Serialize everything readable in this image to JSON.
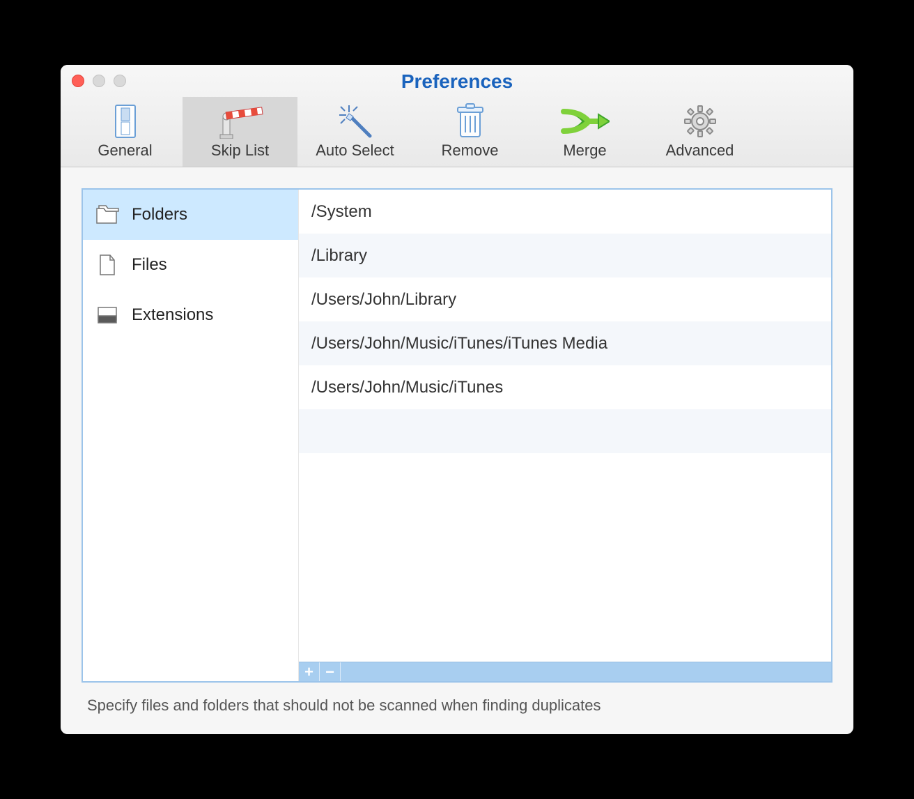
{
  "window": {
    "title": "Preferences"
  },
  "toolbar": {
    "selected_index": 1,
    "items": [
      {
        "label": "General"
      },
      {
        "label": "Skip List"
      },
      {
        "label": "Auto Select"
      },
      {
        "label": "Remove"
      },
      {
        "label": "Merge"
      },
      {
        "label": "Advanced"
      }
    ]
  },
  "sidebar": {
    "selected_index": 0,
    "items": [
      {
        "label": "Folders"
      },
      {
        "label": "Files"
      },
      {
        "label": "Extensions"
      }
    ]
  },
  "skip_list": {
    "rows": [
      "/System",
      "/Library",
      "/Users/John/Library",
      "/Users/John/Music/iTunes/iTunes Media",
      "/Users/John/Music/iTunes"
    ]
  },
  "footer": {
    "add_label": "+",
    "remove_label": "−"
  },
  "hint": "Specify files and folders that should not be scanned when finding duplicates"
}
